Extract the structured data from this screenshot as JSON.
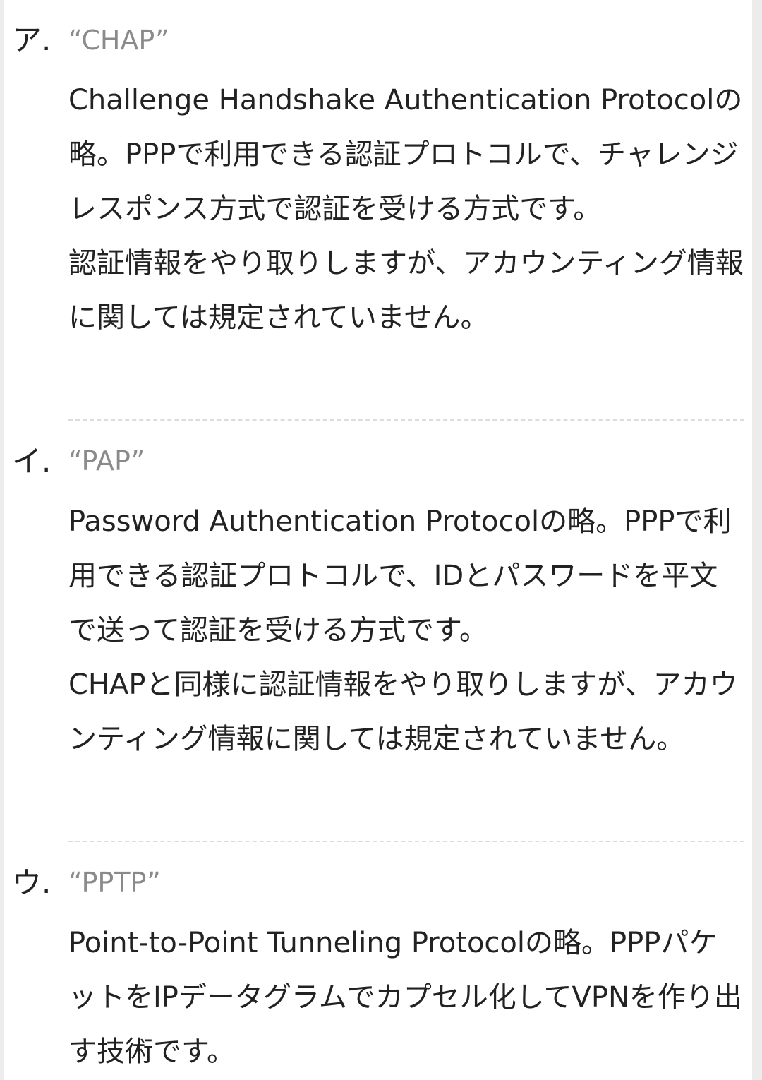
{
  "choices": [
    {
      "mark": "ア.",
      "term": "“CHAP”",
      "description": [
        "Challenge Handshake Authentication Protocolの略。PPPで利用できる認証プロトコルで、チャレンジレスポンス方式で認証を受ける方式です。",
        "認証情報をやり取りしますが、アカウンティング情報に関しては規定されていません。"
      ]
    },
    {
      "mark": "イ.",
      "term": "“PAP”",
      "description": [
        "Password Authentication Protocolの略。PPPで利用できる認証プロトコルで、IDとパスワードを平文で送って認証を受ける方式です。",
        "CHAPと同様に認証情報をやり取りしますが、アカウンティング情報に関しては規定されていません。"
      ]
    },
    {
      "mark": "ウ.",
      "term": "“PPTP”",
      "description": [
        "Point-to-Point Tunneling Protocolの略。PPPパケットをIPデータグラムでカプセル化してVPNを作り出す技術です。"
      ]
    }
  ]
}
